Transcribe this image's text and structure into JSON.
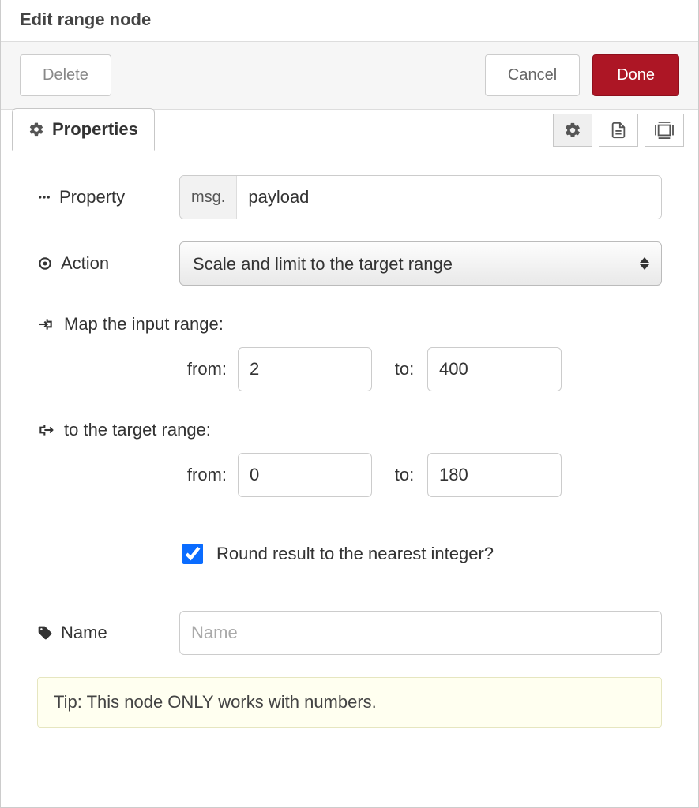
{
  "header": {
    "title": "Edit range node"
  },
  "actions": {
    "delete": "Delete",
    "cancel": "Cancel",
    "done": "Done"
  },
  "tabs": {
    "properties": "Properties"
  },
  "labels": {
    "property": "Property",
    "action": "Action",
    "map_input": "Map the input range:",
    "target_range": "to the target range:",
    "from": "from:",
    "to": "to:",
    "round": "Round result to the nearest integer?",
    "name": "Name",
    "name_placeholder": "Name"
  },
  "values": {
    "property_prefix": "msg.",
    "property": "payload",
    "action_selected": "Scale and limit to the target range",
    "in_from": "2",
    "in_to": "400",
    "out_from": "0",
    "out_to": "180",
    "round_checked": true,
    "name": ""
  },
  "tip": "Tip: This node ONLY works with numbers.",
  "colors": {
    "primary": "#AD1625"
  }
}
